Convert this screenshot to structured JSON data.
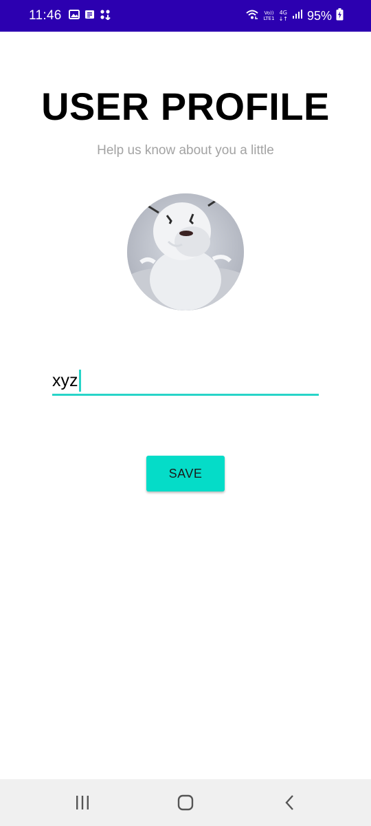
{
  "status_bar": {
    "time": "11:46",
    "network_label": "Vo))\nLTE1",
    "network_type": "4G",
    "battery": "95%",
    "icons": [
      "gallery-icon",
      "message-icon",
      "app-grid-icon",
      "wifi-icon",
      "signal-icon",
      "battery-charging-icon"
    ]
  },
  "main": {
    "title": "USER PROFILE",
    "subtitle": "Help us know about you a little",
    "avatar_icon": "snowman-photo",
    "name_input": {
      "value": "xyz",
      "placeholder": ""
    },
    "save_label": "SAVE"
  },
  "nav_bar": {
    "icons": [
      "recent-apps-icon",
      "home-icon",
      "back-icon"
    ]
  },
  "colors": {
    "status_bar": "#2c00b0",
    "accent": "#05dcc8",
    "underline": "#27d4c8",
    "subtitle": "#a3a3a3",
    "nav_bar": "#f0f0f0"
  }
}
